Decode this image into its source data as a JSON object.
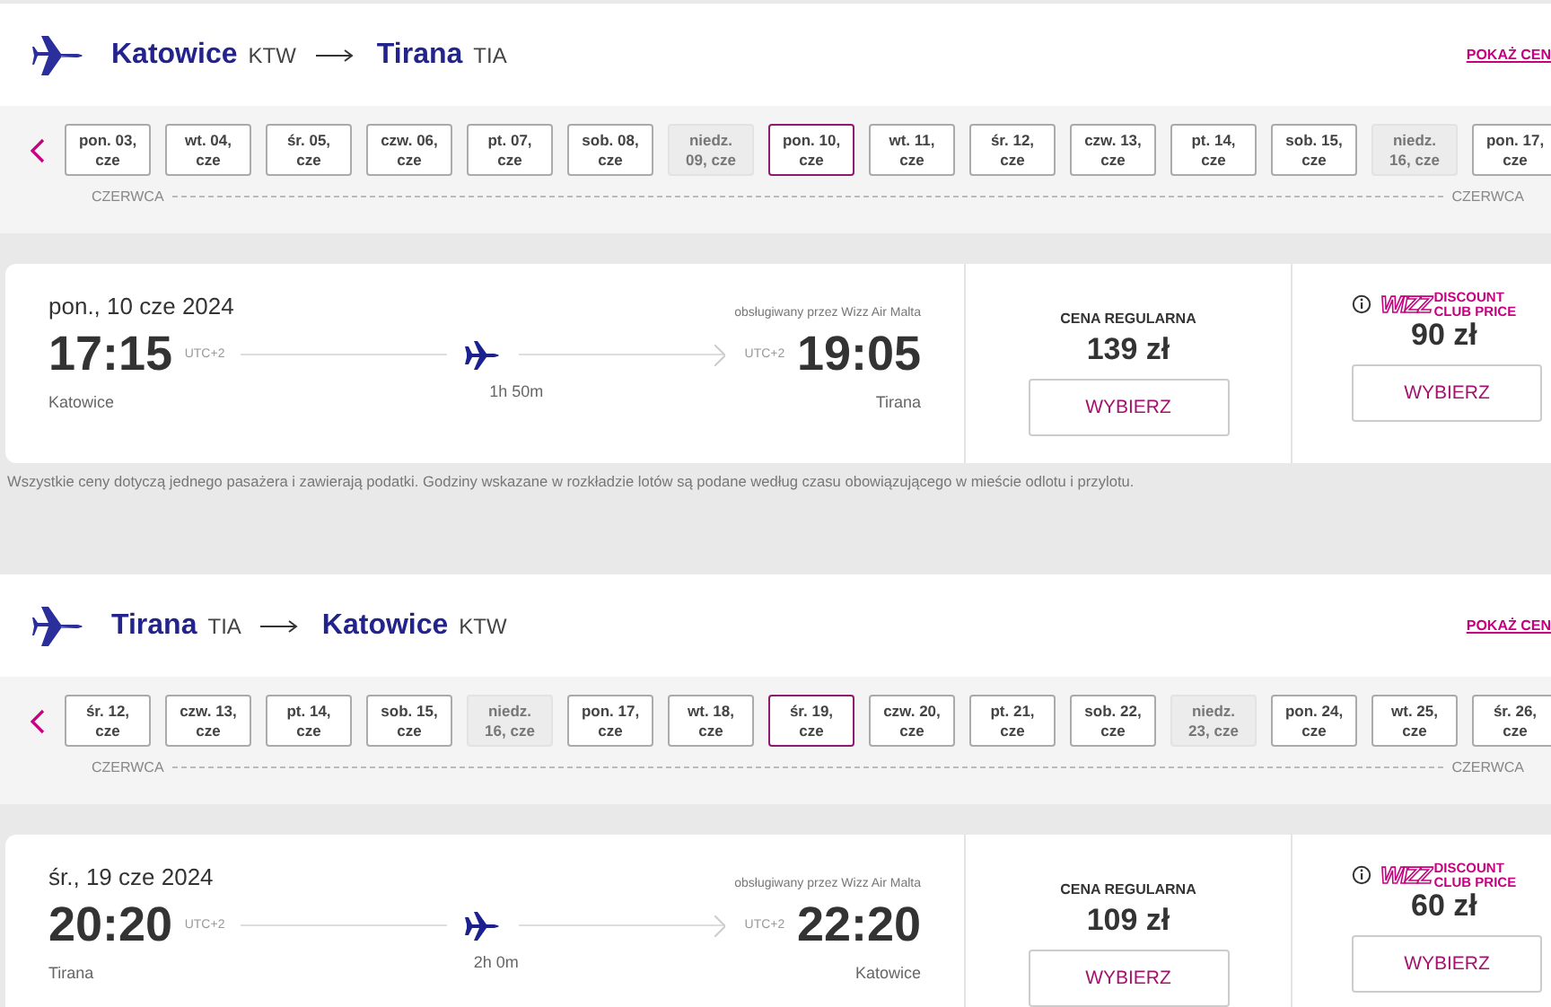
{
  "routes": [
    {
      "origin": {
        "city": "Katowice",
        "code": "KTW"
      },
      "destination": {
        "city": "Tirana",
        "code": "TIA"
      },
      "show_prices_link": "POKAŻ CEN",
      "dates": [
        {
          "lines": [
            "pon. 03,",
            "cze"
          ],
          "selected": false,
          "disabled": false
        },
        {
          "lines": [
            "wt. 04,",
            "cze"
          ],
          "selected": false,
          "disabled": false
        },
        {
          "lines": [
            "śr. 05,",
            "cze"
          ],
          "selected": false,
          "disabled": false
        },
        {
          "lines": [
            "czw. 06,",
            "cze"
          ],
          "selected": false,
          "disabled": false
        },
        {
          "lines": [
            "pt. 07,",
            "cze"
          ],
          "selected": false,
          "disabled": false
        },
        {
          "lines": [
            "sob. 08,",
            "cze"
          ],
          "selected": false,
          "disabled": false
        },
        {
          "lines": [
            "niedz.",
            "09, cze"
          ],
          "selected": false,
          "disabled": true
        },
        {
          "lines": [
            "pon. 10,",
            "cze"
          ],
          "selected": true,
          "disabled": false
        },
        {
          "lines": [
            "wt. 11,",
            "cze"
          ],
          "selected": false,
          "disabled": false
        },
        {
          "lines": [
            "śr. 12,",
            "cze"
          ],
          "selected": false,
          "disabled": false
        },
        {
          "lines": [
            "czw. 13,",
            "cze"
          ],
          "selected": false,
          "disabled": false
        },
        {
          "lines": [
            "pt. 14,",
            "cze"
          ],
          "selected": false,
          "disabled": false
        },
        {
          "lines": [
            "sob. 15,",
            "cze"
          ],
          "selected": false,
          "disabled": false
        },
        {
          "lines": [
            "niedz.",
            "16, cze"
          ],
          "selected": false,
          "disabled": true
        },
        {
          "lines": [
            "pon. 17,",
            "cze"
          ],
          "selected": false,
          "disabled": false
        }
      ],
      "month_labels": [
        "CZERWCA",
        "CZERWCA"
      ],
      "flight": {
        "date": "pon., 10 cze 2024",
        "operator": "obsługiwany przez Wizz Air Malta",
        "departure": {
          "time": "17:15",
          "tz": "UTC+2",
          "city": "Katowice"
        },
        "arrival": {
          "time": "19:05",
          "tz": "UTC+2",
          "city": "Tirana"
        },
        "duration": "1h 50m"
      },
      "fares": [
        {
          "kind": "regular",
          "title": "CENA REGULARNA",
          "price": "139 zł",
          "button": "WYBIERZ"
        },
        {
          "kind": "club",
          "brand": "WIZZ",
          "title": "DISCOUNT CLUB PRICE",
          "price": "90 zł",
          "button": "WYBIERZ"
        }
      ],
      "note": "Wszystkie ceny dotyczą jednego pasażera i zawierają podatki. Godziny wskazane w rozkładzie lotów są podane według czasu obowiązującego w mieście odlotu i przylotu."
    },
    {
      "origin": {
        "city": "Tirana",
        "code": "TIA"
      },
      "destination": {
        "city": "Katowice",
        "code": "KTW"
      },
      "show_prices_link": "POKAŻ CEN",
      "dates": [
        {
          "lines": [
            "śr. 12,",
            "cze"
          ],
          "selected": false,
          "disabled": false
        },
        {
          "lines": [
            "czw. 13,",
            "cze"
          ],
          "selected": false,
          "disabled": false
        },
        {
          "lines": [
            "pt. 14,",
            "cze"
          ],
          "selected": false,
          "disabled": false
        },
        {
          "lines": [
            "sob. 15,",
            "cze"
          ],
          "selected": false,
          "disabled": false
        },
        {
          "lines": [
            "niedz.",
            "16, cze"
          ],
          "selected": false,
          "disabled": true
        },
        {
          "lines": [
            "pon. 17,",
            "cze"
          ],
          "selected": false,
          "disabled": false
        },
        {
          "lines": [
            "wt. 18,",
            "cze"
          ],
          "selected": false,
          "disabled": false
        },
        {
          "lines": [
            "śr. 19,",
            "cze"
          ],
          "selected": true,
          "disabled": false
        },
        {
          "lines": [
            "czw. 20,",
            "cze"
          ],
          "selected": false,
          "disabled": false
        },
        {
          "lines": [
            "pt. 21,",
            "cze"
          ],
          "selected": false,
          "disabled": false
        },
        {
          "lines": [
            "sob. 22,",
            "cze"
          ],
          "selected": false,
          "disabled": false
        },
        {
          "lines": [
            "niedz.",
            "23, cze"
          ],
          "selected": false,
          "disabled": true
        },
        {
          "lines": [
            "pon. 24,",
            "cze"
          ],
          "selected": false,
          "disabled": false
        },
        {
          "lines": [
            "wt. 25,",
            "cze"
          ],
          "selected": false,
          "disabled": false
        },
        {
          "lines": [
            "śr. 26,",
            "cze"
          ],
          "selected": false,
          "disabled": false
        }
      ],
      "month_labels": [
        "CZERWCA",
        "CZERWCA"
      ],
      "flight": {
        "date": "śr., 19 cze 2024",
        "operator": "obsługiwany przez Wizz Air Malta",
        "departure": {
          "time": "20:20",
          "tz": "UTC+2",
          "city": "Tirana"
        },
        "arrival": {
          "time": "22:20",
          "tz": "UTC+2",
          "city": "Katowice"
        },
        "duration": "2h 0m"
      },
      "fares": [
        {
          "kind": "regular",
          "title": "CENA REGULARNA",
          "price": "109 zł",
          "button": "WYBIERZ"
        },
        {
          "kind": "club",
          "brand": "WIZZ",
          "title": "DISCOUNT CLUB PRICE",
          "price": "60 zł",
          "button": "WYBIERZ"
        }
      ]
    }
  ]
}
